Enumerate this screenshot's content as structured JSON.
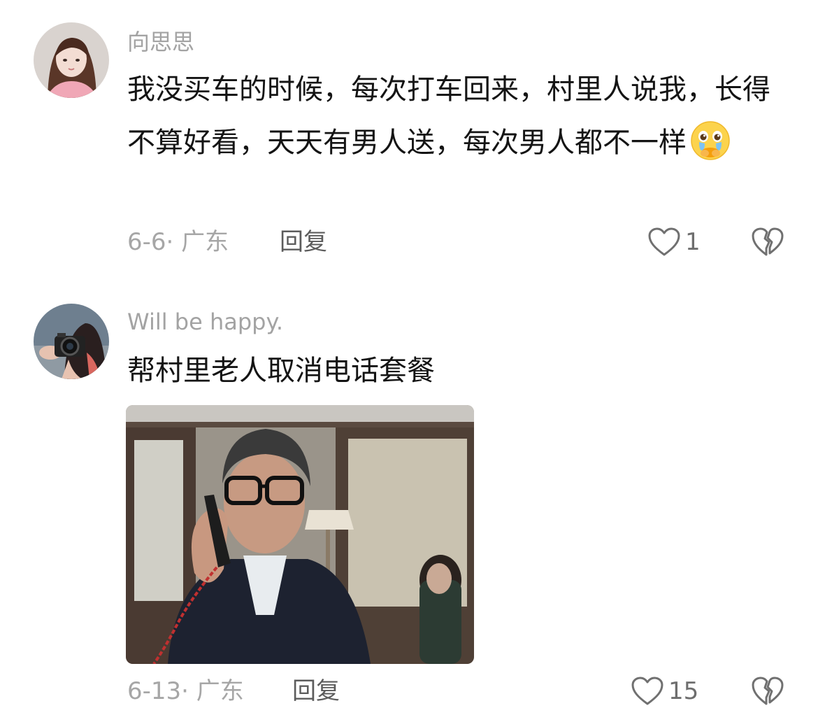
{
  "comments": [
    {
      "username": "向思思",
      "avatar_icon": "avatar-icon",
      "text": "我没买车的时候，每次打车回来，村里人说我，长得不算好看，天天有男人送，每次男人都不一样",
      "emoji_icon": "crying-face-emoji-icon",
      "meta": "6-6· 广东",
      "reply_label": "回复",
      "like_icon": "heart-icon",
      "likes": "1",
      "dislike_icon": "broken-heart-icon"
    },
    {
      "username": "Will be happy.",
      "avatar_icon": "avatar-icon",
      "text": "帮村里老人取消电话套餐",
      "image_icon": "man-on-phone-photo",
      "meta": "6-13· 广东",
      "reply_label": "回复",
      "like_icon": "heart-icon",
      "likes": "15",
      "dislike_icon": "broken-heart-icon"
    }
  ],
  "colors": {
    "username": "#a3a3a3",
    "meta": "#a6a6a6",
    "reply": "#5c5c5c",
    "text": "#141414"
  }
}
